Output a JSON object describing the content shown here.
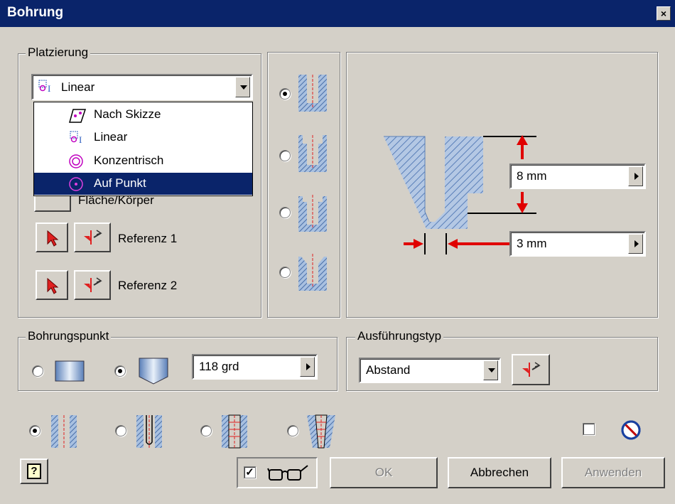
{
  "window": {
    "title": "Bohrung",
    "close": "×"
  },
  "placement": {
    "legend": "Platzierung",
    "selected": "Linear",
    "options": [
      "Nach Skizze",
      "Linear",
      "Konzentrisch",
      "Auf Punkt"
    ],
    "highlighted_index": 3,
    "hidden_partial_label": "Fläche/Körper",
    "reference1": "Referenz 1",
    "reference2": "Referenz 2"
  },
  "dimensions": {
    "depth": "8 mm",
    "diameter": "3 mm"
  },
  "drill_point": {
    "legend": "Bohrungspunkt",
    "angle": "118 grd",
    "selected": "angled"
  },
  "termination": {
    "legend": "Ausführungstyp",
    "value": "Abstand"
  },
  "hole_type_selected": "simple",
  "bottom": {
    "ok": "OK",
    "cancel": "Abbrechen",
    "apply": "Anwenden",
    "help": "?"
  },
  "colors": {
    "title_bar": "#0a246a",
    "face": "#d4d0c8",
    "hatch": "#6f96c8",
    "arrow": "#ff0000",
    "highlight": "#0a246a"
  }
}
